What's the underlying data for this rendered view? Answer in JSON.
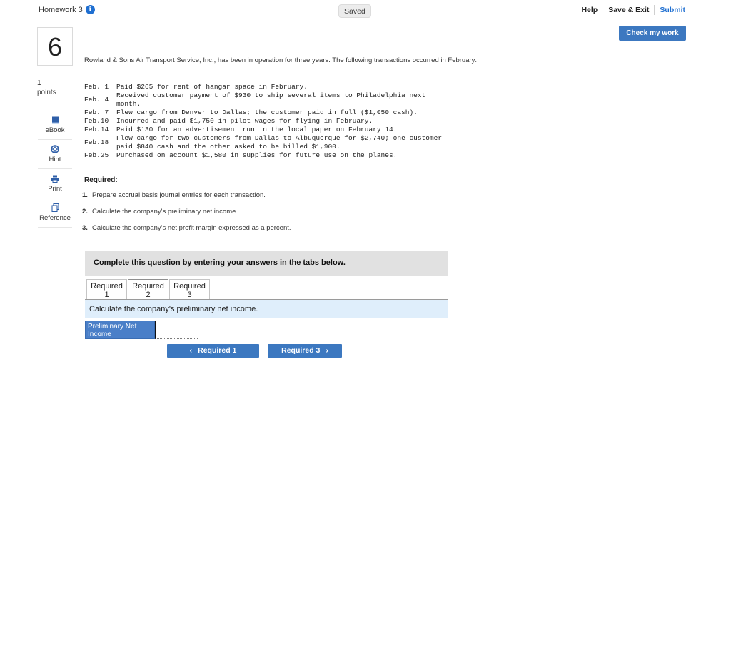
{
  "header": {
    "title": "Homework 3",
    "info_icon": "i",
    "saved": "Saved",
    "help": "Help",
    "save_exit": "Save & Exit",
    "submit": "Submit",
    "check_my_work": "Check my work",
    "accent_color": "#3c78c0"
  },
  "question": {
    "number": "6",
    "points_value": "1",
    "points_label": "points"
  },
  "side_tools": [
    {
      "label": "eBook",
      "icon": "book-icon"
    },
    {
      "label": "Hint",
      "icon": "lifebuoy-icon"
    },
    {
      "label": "Print",
      "icon": "printer-icon"
    },
    {
      "label": "Reference",
      "icon": "document-icon"
    }
  ],
  "problem": {
    "intro": "Rowland & Sons Air Transport Service, Inc., has been in operation for three years. The following transactions occurred in February:",
    "transactions": [
      {
        "date": "Feb. 1",
        "text": "Paid $265 for rent of hangar space in February."
      },
      {
        "date": "Feb. 4",
        "text": "Received customer payment of $930 to ship several items to Philadelphia next\nmonth."
      },
      {
        "date": "Feb. 7",
        "text": "Flew cargo from Denver to Dallas; the customer paid in full ($1,050 cash)."
      },
      {
        "date": "Feb.10",
        "text": "Incurred and paid $1,750 in pilot wages for flying in February."
      },
      {
        "date": "Feb.14",
        "text": "Paid $130 for an advertisement run in the local paper on February 14."
      },
      {
        "date": "Feb.18",
        "text": "Flew cargo for two customers from Dallas to Albuquerque for $2,740; one customer\npaid $840 cash and the other asked to be billed $1,900."
      },
      {
        "date": "Feb.25",
        "text": "Purchased on account $1,580 in supplies for future use on the planes."
      }
    ],
    "required_title": "Required:",
    "requirements": [
      {
        "num": "1.",
        "text": "Prepare accrual basis journal entries for each transaction."
      },
      {
        "num": "2.",
        "text": "Calculate the company's preliminary net income."
      },
      {
        "num": "3.",
        "text": "Calculate the company's net profit margin expressed as a percent."
      }
    ]
  },
  "answer_area": {
    "banner": "Complete this question by entering your answers in the tabs below.",
    "tabs": [
      {
        "line1": "Required",
        "line2": "1"
      },
      {
        "line1": "Required",
        "line2": "2"
      },
      {
        "line1": "Required",
        "line2": "3"
      }
    ],
    "active_tab": 1,
    "instruction": "Calculate the company's preliminary net income.",
    "field_label": "Preliminary Net Income",
    "field_value": "",
    "prev_button": "Required 1",
    "next_button": "Required 3"
  }
}
